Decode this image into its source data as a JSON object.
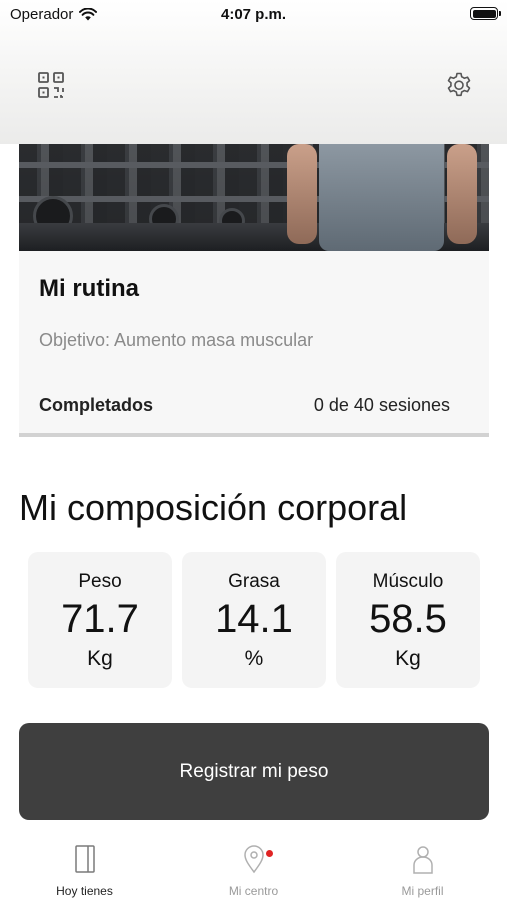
{
  "status_bar": {
    "carrier": "Operador",
    "time": "4:07 p.m."
  },
  "header": {
    "left_icon": "qr-code-icon",
    "right_icon": "gear-icon"
  },
  "routine": {
    "title": "Mi rutina",
    "goal": "Objetivo: Aumento masa muscular",
    "completed_label": "Completados",
    "completed_value": "0 de 40 sesiones"
  },
  "composition": {
    "title": "Mi composición corporal",
    "metrics": [
      {
        "label": "Peso",
        "value": "71.7",
        "unit": "Kg"
      },
      {
        "label": "Grasa",
        "value": "14.1",
        "unit": "%"
      },
      {
        "label": "Músculo",
        "value": "58.5",
        "unit": "Kg"
      }
    ]
  },
  "register_button": "Registrar mi peso",
  "tabs": [
    {
      "label": "Hoy tienes",
      "icon": "notebook-icon",
      "active": true
    },
    {
      "label": "Mi centro",
      "icon": "map-pin-icon",
      "active": false,
      "badge_color": "#e02424"
    },
    {
      "label": "Mi perfil",
      "icon": "person-icon",
      "active": false
    }
  ]
}
